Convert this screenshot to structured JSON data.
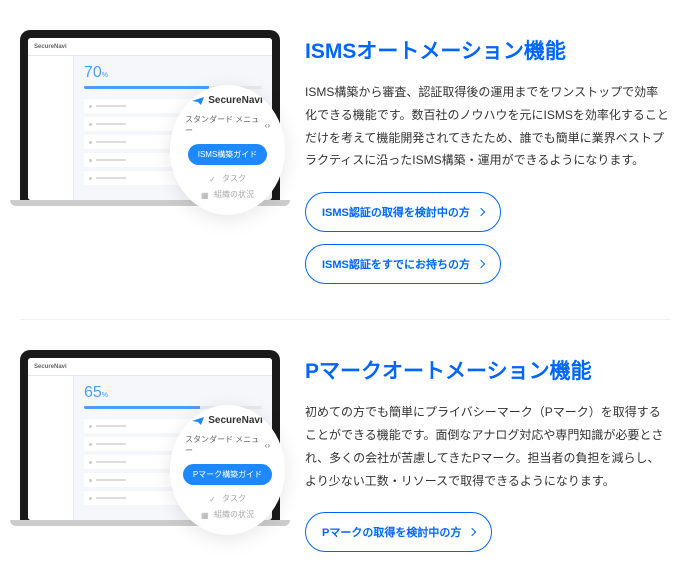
{
  "brand": "SecureNavi",
  "sections": [
    {
      "title": "ISMSオートメーション機能",
      "desc": "ISMS構築から審査、認証取得後の運用までをワンストップで効率化できる機能です。数百社のノウハウを元にISMSを効率化することだけを考えて機能開発されてきたため、誰でも簡単に業界ベストプラクティスに沿ったISMS構築・運用ができるようになります。",
      "mock": {
        "percent": "70",
        "percent_unit": "%",
        "bar_width": "70%",
        "menu_label": "スタンダード メニュー",
        "pill": "ISMS構築ガイド",
        "item1": "タスク",
        "item2": "組織の状況"
      },
      "buttons": [
        {
          "label": "ISMS認証の取得を検討中の方"
        },
        {
          "label": "ISMS認証をすでにお持ちの方"
        }
      ]
    },
    {
      "title": "Pマークオートメーション機能",
      "desc": "初めての方でも簡単にプライバシーマーク（Pマーク）を取得することができる機能です。面倒なアナログ対応や専門知識が必要とされ、多くの会社が苦慮してきたPマーク。担当者の負担を減らし、より少ない工数・リソースで取得できるようになります。",
      "mock": {
        "percent": "65",
        "percent_unit": "%",
        "bar_width": "65%",
        "menu_label": "スタンダード メニュー",
        "pill": "Pマーク構築ガイド",
        "item1": "タスク",
        "item2": "組織の状況"
      },
      "buttons": [
        {
          "label": "Pマークの取得を検討中の方"
        }
      ]
    }
  ]
}
